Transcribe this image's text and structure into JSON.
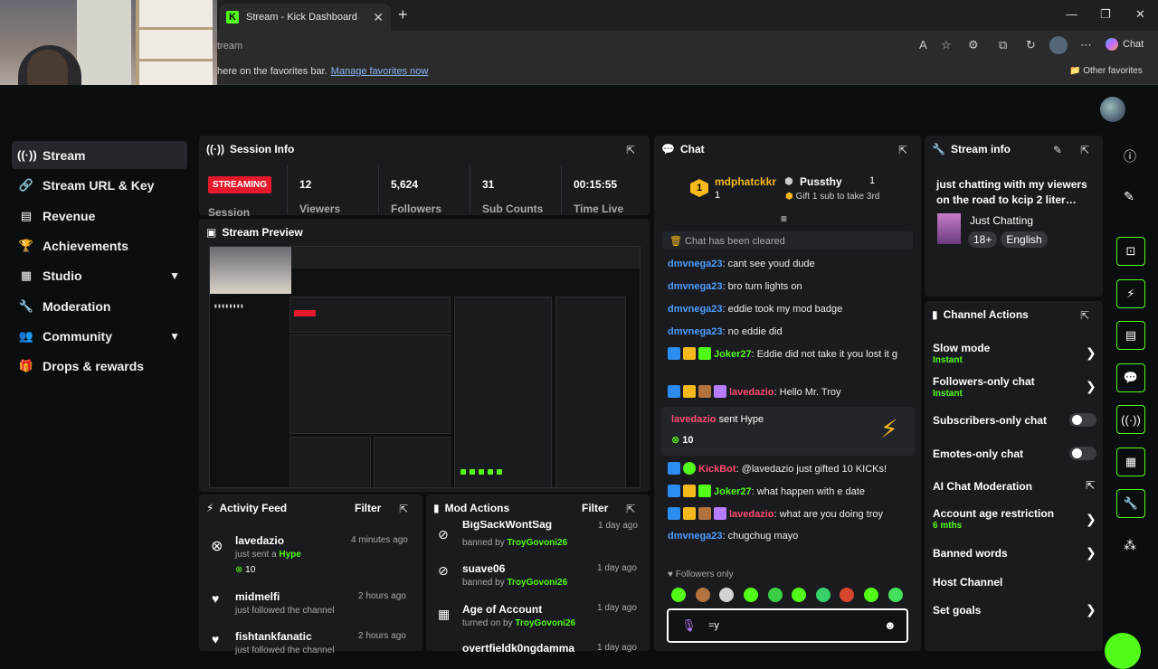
{
  "browser": {
    "tab_title": "Stream - Kick Dashboard",
    "tab_close": "✕",
    "new_tab": "+",
    "favicon": "K",
    "address": "tream",
    "copilot_label": "Chat",
    "favbar_text": "here on the favorites bar.",
    "favbar_link": "Manage favorites now",
    "other_favorites": "Other favorites"
  },
  "sidebar": {
    "items": [
      {
        "label": "Stream",
        "icon": "stream-icon"
      },
      {
        "label": "Stream URL & Key",
        "icon": "link-icon"
      },
      {
        "label": "Revenue",
        "icon": "money-icon"
      },
      {
        "label": "Achievements",
        "icon": "trophy-icon"
      },
      {
        "label": "Studio",
        "icon": "studio-icon"
      },
      {
        "label": "Moderation",
        "icon": "wrench-icon"
      },
      {
        "label": "Community",
        "icon": "community-icon"
      },
      {
        "label": "Drops & rewards",
        "icon": "gift-icon"
      }
    ]
  },
  "session": {
    "title": "Session Info",
    "status": "STREAMING",
    "session_label": "Session",
    "stats": [
      {
        "value": "12",
        "label": "Viewers"
      },
      {
        "value": "5,624",
        "label": "Followers"
      },
      {
        "value": "31",
        "label": "Sub Counts"
      },
      {
        "value": "00:15:55",
        "label": "Time Live"
      }
    ]
  },
  "preview": {
    "title": "Stream Preview"
  },
  "activity": {
    "title": "Activity Feed",
    "filter": "Filter",
    "items": [
      {
        "name": "lavedazio",
        "text": "just sent a",
        "highlight": "Hype",
        "amount": "10",
        "time": "4 minutes ago"
      },
      {
        "name": "midmelfi",
        "text": "just followed the channel",
        "time": "2 hours ago"
      },
      {
        "name": "fishtankfanatic",
        "text": "just followed the channel",
        "time": "2 hours ago"
      }
    ]
  },
  "mod": {
    "title": "Mod Actions",
    "filter": "Filter",
    "items": [
      {
        "name": "BigSackWontSag",
        "action": "banned by",
        "by": "TroyGovoni26",
        "time": "1 day ago"
      },
      {
        "name": "suave06",
        "action": "banned by",
        "by": "TroyGovoni26",
        "time": "1 day ago"
      },
      {
        "name": "Age of Account",
        "action": "turned on by",
        "by": "TroyGovoni26",
        "time": "1 day ago"
      },
      {
        "name": "overtfieldk0ngdamma",
        "action": "",
        "by": "",
        "time": "1 day ago"
      }
    ]
  },
  "chat": {
    "title": "Chat",
    "leader1": {
      "name": "mdphatckkr",
      "count": "1"
    },
    "leader2": {
      "name": "Pussthy",
      "count": "1",
      "sub": "Gift 1 sub to take 3rd"
    },
    "cleared": "Chat has been cleared",
    "messages": [
      {
        "user": "dmvnega23",
        "text": ": cant see youd dude"
      },
      {
        "user": "dmvnega23",
        "text": ": bro turn lights on"
      },
      {
        "user": "dmvnega23",
        "text": ": eddie took my mod badge"
      },
      {
        "user": "dmvnega23",
        "text": ": no eddie did"
      },
      {
        "user": "Joker27",
        "text": ": Eddie did not take it you lost it g"
      },
      {
        "user": "lavedazio",
        "text": ": Hello Mr. Troy"
      },
      {
        "user": "KickBot",
        "text": ": @lavedazio just gifted 10 KICKs!"
      },
      {
        "user": "Joker27",
        "text": ": what happen with e date"
      },
      {
        "user": "lavedazio",
        "text": ": what are you doing troy"
      },
      {
        "user": "dmvnega23",
        "text": ": chugchug mayo"
      }
    ],
    "hype": {
      "user": "lavedazio",
      "text": "sent Hype",
      "amount": "10"
    },
    "followers_only": "Followers only",
    "input_value": "=y"
  },
  "streaminfo": {
    "title": "Stream info",
    "stream_title": "just chatting with my viewers on the road to kcip 2 liter…",
    "category": "Just Chatting",
    "tags": [
      "18+",
      "English"
    ]
  },
  "actions": {
    "title": "Channel Actions",
    "items": [
      {
        "label": "Slow mode",
        "sub": "Instant",
        "type": "chevron"
      },
      {
        "label": "Followers-only chat",
        "sub": "Instant",
        "type": "chevron"
      },
      {
        "label": "Subscribers-only chat",
        "sub": "",
        "type": "toggle"
      },
      {
        "label": "Emotes-only chat",
        "sub": "",
        "type": "toggle"
      },
      {
        "label": "AI Chat Moderation",
        "sub": "",
        "type": "external"
      },
      {
        "label": "Account age restriction",
        "sub": "6 mths",
        "type": "chevron"
      },
      {
        "label": "Banned words",
        "sub": "",
        "type": "chevron"
      },
      {
        "label": "Host Channel",
        "sub": "",
        "type": "none"
      },
      {
        "label": "Set goals",
        "sub": "",
        "type": "chevron"
      }
    ]
  },
  "colors": {
    "accent": "#53fc18",
    "live": "#e5192b",
    "panel": "#191b1f",
    "bg": "#0b0e0f"
  }
}
